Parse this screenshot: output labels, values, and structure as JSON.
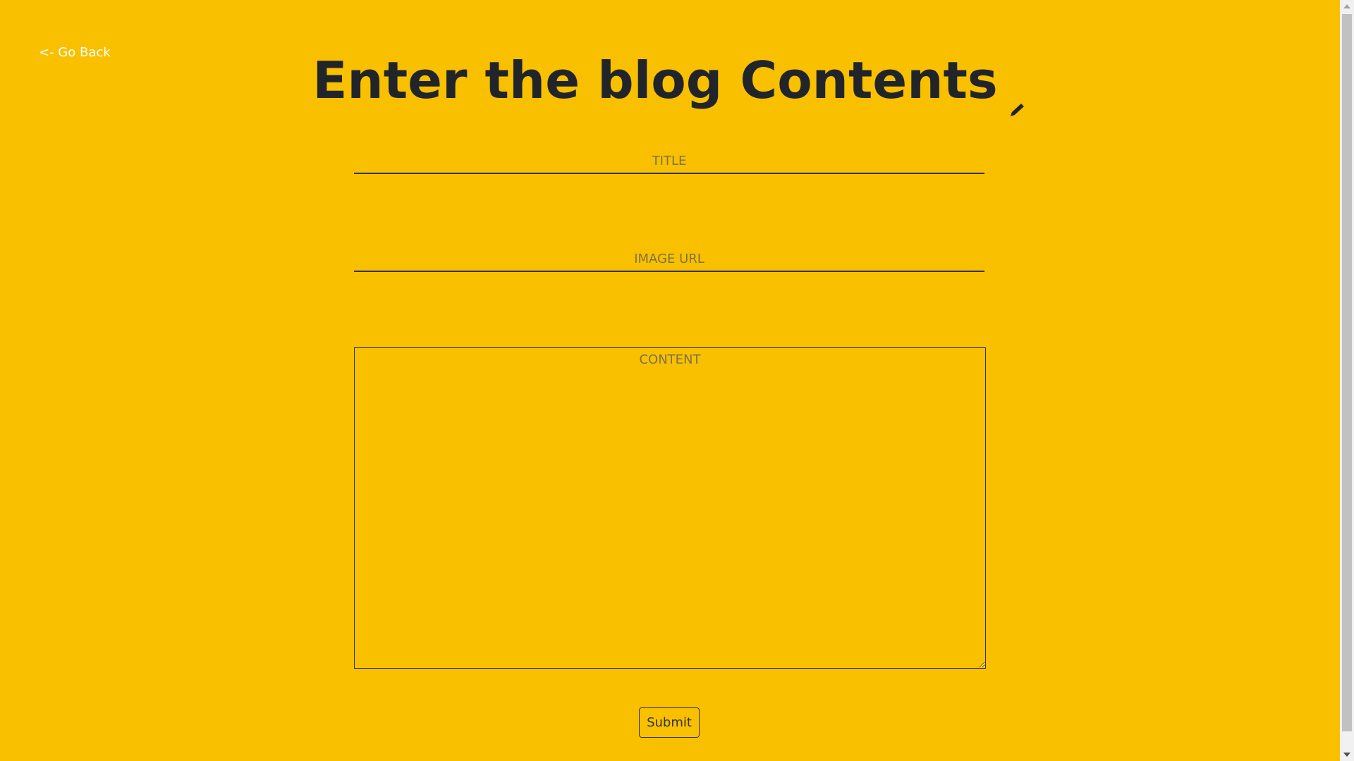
{
  "nav": {
    "go_back_label": "<- Go Back"
  },
  "header": {
    "title": "Enter the blog Contents",
    "title_icon": "pen-icon"
  },
  "form": {
    "title_field": {
      "placeholder": "TITLE",
      "value": ""
    },
    "image_url_field": {
      "placeholder": "IMAGE URL",
      "value": ""
    },
    "content_field": {
      "placeholder": "CONTENT",
      "value": ""
    },
    "submit_label": "Submit"
  },
  "colors": {
    "background": "#F9C000",
    "heading": "#212529",
    "link": "#FFFFFF",
    "border": "#333333"
  }
}
